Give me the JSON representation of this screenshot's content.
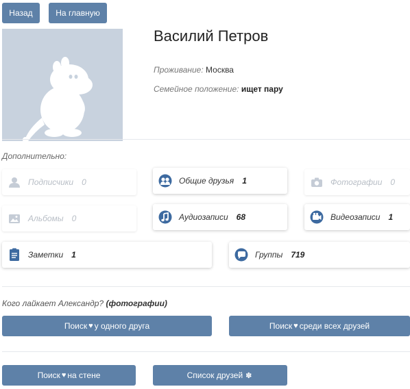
{
  "nav": {
    "back_label": "Назад",
    "home_label": "На главную"
  },
  "profile": {
    "name": "Василий Петров",
    "residence_label": "Проживание:",
    "residence_value": "Москва",
    "family_label": "Семейное положение:",
    "family_value": "ищет пару"
  },
  "extra": {
    "title": "Дополнительно:",
    "items": [
      {
        "label": "Подписчики",
        "count": "0",
        "icon": "subscribers-icon"
      },
      {
        "label": "Общие друзья",
        "count": "1",
        "icon": "mutual-friends-icon"
      },
      {
        "label": "Фотографии",
        "count": "0",
        "icon": "camera-icon"
      },
      {
        "label": "Альбомы",
        "count": "0",
        "icon": "albums-icon"
      },
      {
        "label": "Аудиозаписи",
        "count": "68",
        "icon": "music-note-icon"
      },
      {
        "label": "Видеозаписи",
        "count": "1",
        "icon": "video-camera-icon"
      },
      {
        "label": "Заметки",
        "count": "1",
        "icon": "notes-icon"
      },
      {
        "label": "Группы",
        "count": "719",
        "icon": "groups-icon"
      }
    ]
  },
  "likes": {
    "question": "Кого лайкает Александр?",
    "photos_link": "(фотографии)",
    "search_one_friend": {
      "prefix": "Поиск",
      "suffix": "у одного друга"
    },
    "search_all_friends": {
      "prefix": "Поиск",
      "suffix": "среди всех друзей"
    },
    "search_wall": {
      "prefix": "Поиск",
      "suffix": "на стене"
    },
    "friends_list": "Список друзей",
    "heart_glyph": "♥",
    "gear_glyph": "✽"
  },
  "colors": {
    "accent": "#5e81a8",
    "avatar_bg": "#c8d2de",
    "dim_text": "#b8bec6"
  }
}
